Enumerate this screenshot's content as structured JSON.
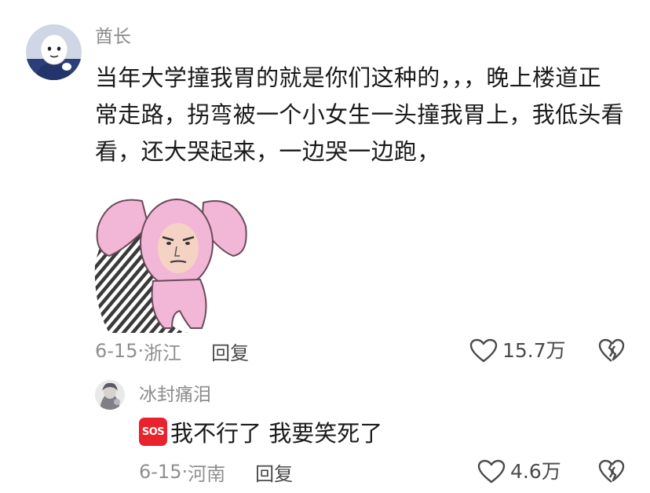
{
  "comment": {
    "username": "酋长",
    "text_lines": [
      "当年大学撞我胃的就是你们这种的，，，晚上楼道正",
      "常走路，拐弯被一个小女生一头撞我胃上，我低头看",
      "看，还大哭起来，一边哭一边跑，"
    ],
    "date": "6-15",
    "location": "浙江",
    "reply_label": "回复",
    "likes": "15.7万"
  },
  "reply": {
    "username": "冰封痛泪",
    "badge": "SOS",
    "text": "我不行了 我要笑死了",
    "date": "6-15",
    "location": "河南",
    "reply_label": "回复",
    "likes": "4.6万"
  },
  "colors": {
    "text_primary": "#1a1a1a",
    "text_secondary": "#8f8f8f",
    "sos_badge": "#e8232d",
    "sticker_pink": "#f2b7d6"
  },
  "icons": {
    "like": "heart-outline-icon",
    "dislike": "broken-heart-icon",
    "sos": "sos-emoji-icon"
  }
}
